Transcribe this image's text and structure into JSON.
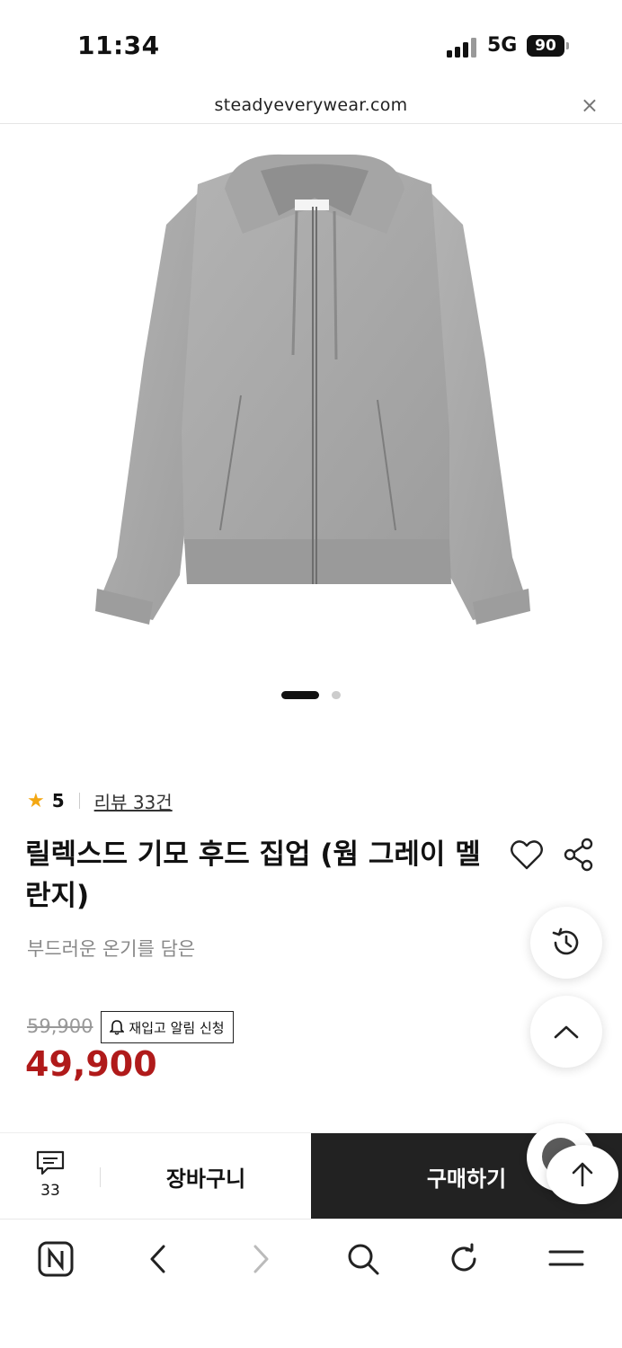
{
  "status_bar": {
    "time": "11:34",
    "network": "5G",
    "battery": "90"
  },
  "url_bar": {
    "domain": "steadyeverywear.com",
    "close_label": "×"
  },
  "product": {
    "rating_score": "5",
    "review_link": "리뷰 33건",
    "title": "릴렉스드 기모 후드 집업 (웜 그레이 멜란지)",
    "subtitle": "부드러운 온기를 담은",
    "original_price": "59,900",
    "restock_label": "재입고 알림 신청",
    "sale_price": "49,900",
    "image_count": 2,
    "image_index": 1,
    "colors": {
      "sale": "#b01a1a",
      "star": "#f3a712",
      "hoodie": "#a9a9a9"
    }
  },
  "action_bar": {
    "chat_count": "33",
    "cart_label": "장바구니",
    "buy_label": "구매하기"
  },
  "icons": [
    "star-icon",
    "heart-icon",
    "share-icon",
    "bell-icon",
    "history-icon",
    "chevron-up-icon",
    "chat-icon",
    "arrow-up-icon",
    "naver-icon",
    "back-icon",
    "forward-icon",
    "search-icon",
    "refresh-icon",
    "menu-icon"
  ]
}
